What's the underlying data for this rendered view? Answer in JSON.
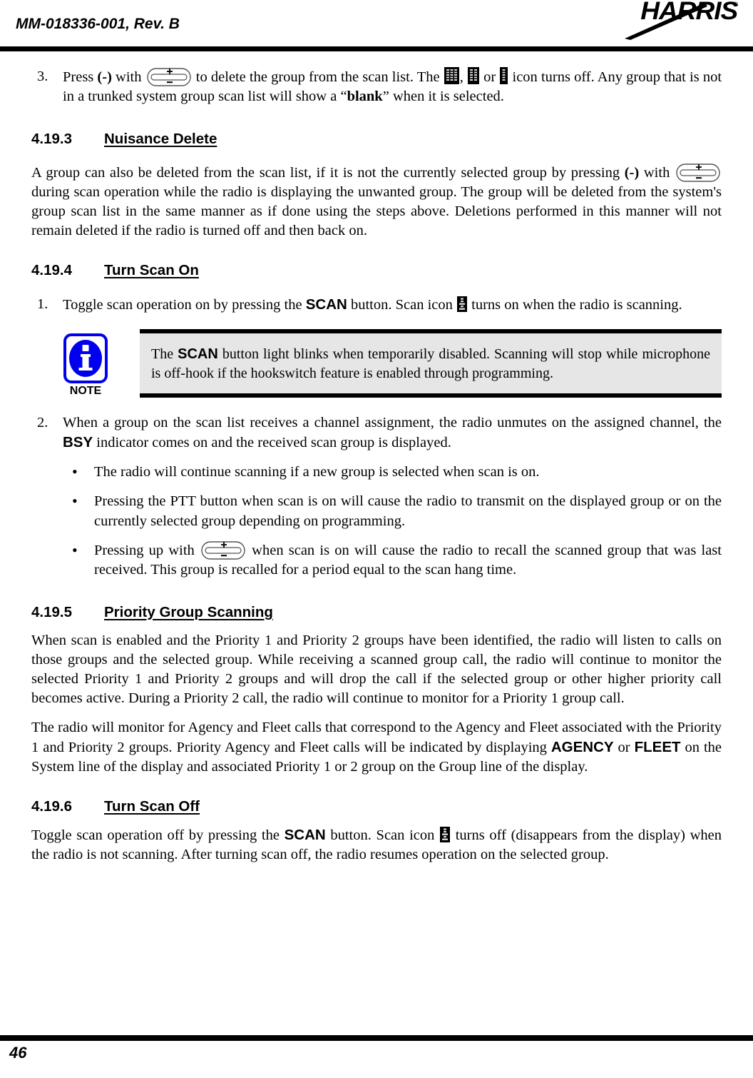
{
  "header": {
    "doc_id": "MM-018336-001, Rev. B",
    "logo_text": "HARRIS",
    "logo_registered": "®"
  },
  "footer": {
    "page_number": "46"
  },
  "icons": {
    "rocker": "plus-minus-rocker-icon",
    "scan_list_3": "scan-list-icon-3-bars",
    "scan_list_2": "scan-list-icon-2-bars",
    "scan_list_1": "scan-list-icon-1-bar",
    "scan": "scan-icon",
    "note": "note-info-icon"
  },
  "colors": {
    "note_blue": "#0000EE",
    "note_box_bg": "#E6E6E6",
    "rule_black": "#000000"
  },
  "body": {
    "step3": {
      "number": "3.",
      "t1": "Press ",
      "minus": "(-)",
      "t2": " with ",
      "t3": " to delete the group from the scan list. The ",
      "t4": ", ",
      "t5": " or ",
      "t6": " icon turns off. Any group that is not in a trunked system group scan list will show a “",
      "blank": "blank",
      "t7": "” when it is selected."
    },
    "s4193": {
      "num": "4.19.3",
      "title": "Nuisance Delete",
      "p1a": "A group can also be deleted from the scan list, if it is not the currently selected group by pressing ",
      "minus": "(-)",
      "p1b": " with ",
      "p1c": " during scan operation while the radio is displaying the unwanted group. The group will be deleted from the system's group scan list in the same manner as if done using the steps above. Deletions performed in this manner will not remain deleted if the radio is turned off and then back on."
    },
    "s4194": {
      "num": "4.19.4",
      "title": "Turn Scan On",
      "step1": {
        "number": "1.",
        "a": "Toggle scan operation on by pressing the ",
        "scan": "SCAN",
        "b": " button. Scan icon ",
        "c": " turns on when the radio is scanning."
      },
      "note": {
        "label": "NOTE",
        "a": "The ",
        "scan": "SCAN",
        "b": " button light blinks when temporarily disabled. Scanning will stop while microphone is off-hook if the hookswitch feature is enabled through programming."
      },
      "step2": {
        "number": "2.",
        "a": "When a group on the scan list receives a channel assignment, the radio unmutes on the assigned channel, the ",
        "bsy": "BSY",
        "b": " indicator comes on and the received scan group is displayed."
      },
      "bullets": [
        {
          "bullet": "•",
          "text": "The radio will continue scanning if a new group is selected when scan is on."
        },
        {
          "bullet": "•",
          "text": "Pressing the PTT button when scan is on will cause the radio to transmit on the displayed group or on the currently selected group depending on programming."
        },
        {
          "bullet": "•",
          "a": "Pressing up with ",
          "b": " when scan is on will cause the radio to recall the scanned group that was last received. This group is recalled for a period equal to the scan hang time."
        }
      ]
    },
    "s4195": {
      "num": "4.19.5",
      "title": "Priority Group Scanning",
      "p1": "When scan is enabled and the Priority 1 and Priority 2 groups have been identified, the radio will listen to calls on those groups and the selected group. While receiving a scanned group call, the radio will continue to monitor the selected Priority 1 and Priority 2 groups and will drop the call if the selected group or other higher priority call becomes active. During a Priority 2 call, the radio will continue to monitor for a Priority 1 group call.",
      "p2a": "The radio will monitor for Agency and Fleet calls that correspond to the Agency and Fleet associated with the Priority 1 and Priority 2 groups. Priority Agency and Fleet calls will be indicated by displaying ",
      "agency": "AGENCY",
      "p2b": " or ",
      "fleet": "FLEET",
      "p2c": " on the System line of the display and associated Priority 1 or 2 group on the Group line of the display."
    },
    "s4196": {
      "num": "4.19.6",
      "title": "Turn Scan Off",
      "p1a": "Toggle scan operation off by pressing the ",
      "scan": "SCAN",
      "p1b": " button. Scan icon ",
      "p1c": " turns off (disappears from the display) when the radio is not scanning. After turning scan off, the radio resumes operation on the selected group."
    }
  }
}
